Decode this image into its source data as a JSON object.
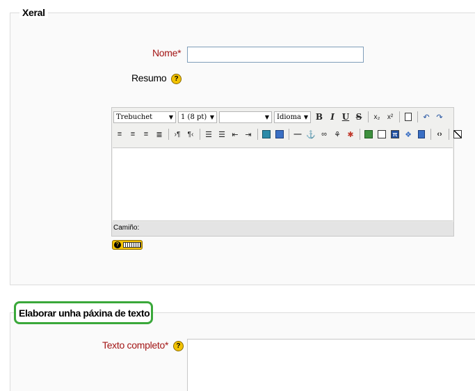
{
  "section_general": {
    "legend": "Xeral",
    "name_label": "Nome",
    "required_mark": "*",
    "name_value": "",
    "summary_label": "Resumo",
    "help_glyph": "?"
  },
  "editor": {
    "font_family": "Trebuchet",
    "font_size": "1 (8 pt)",
    "heading": "",
    "language": "Idioma",
    "bold": "B",
    "italic": "I",
    "underline": "U",
    "strike": "S",
    "subscript": "x₂",
    "superscript": "x²",
    "path_label": "Camiño:",
    "icons": [
      "align-left-icon",
      "align-center-icon",
      "align-right-icon",
      "justify-icon",
      "ltr-icon",
      "rtl-icon",
      "ordered-list-icon",
      "unordered-list-icon",
      "outdent-icon",
      "indent-icon",
      "text-color-icon",
      "bg-color-icon",
      "hr-icon",
      "anchor-icon",
      "link-icon",
      "unlink-icon",
      "nolink-icon",
      "image-icon",
      "table-icon",
      "math-icon",
      "emoticon-icon",
      "special-char-icon",
      "html-source-icon",
      "fullscreen-icon",
      "undo-icon",
      "redo-icon",
      "paste-word-icon"
    ]
  },
  "section_text_page": {
    "legend": "Elaborar unha páxina de texto",
    "full_text_label": "Texto completo",
    "required_mark": "*"
  }
}
